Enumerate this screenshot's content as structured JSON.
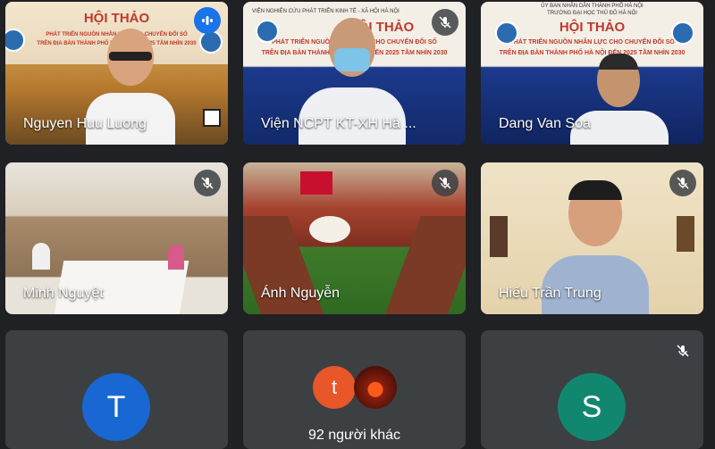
{
  "banner": {
    "org_top": "ỦY BAN NHÂN DÂN THÀNH PHỐ HÀ NỘI",
    "org_sub_left": "VIỆN NGHIÊN CỨU PHÁT TRIỂN KINH TẾ - XÃ HỘI HÀ NỘI",
    "org_sub_right": "TRƯỜNG ĐẠI HỌC THỦ ĐÔ HÀ NỘI",
    "title": "HỘI THẢO",
    "line1": "PHÁT TRIỂN NGUỒN NHÂN LỰC CHO CHUYỂN ĐỔI SỐ",
    "line2": "TRÊN ĐỊA BÀN THÀNH PHỐ HÀ NỘI ĐẾN 2025 TẦM NHÌN 2030"
  },
  "participants": [
    {
      "name": "Nguyen Huu Luong",
      "state": "speaking"
    },
    {
      "name": "Viện NCPT KT-XH Hà ...",
      "state": "muted"
    },
    {
      "name": "Dang Van Soa",
      "state": "unmuted"
    },
    {
      "name": "Minh Nguyệt",
      "state": "muted"
    },
    {
      "name": "Ánh Nguyễn",
      "state": "muted"
    },
    {
      "name": "Hiếu Trần Trung",
      "state": "muted"
    },
    {
      "name": "",
      "initial": "T",
      "state": "unmuted",
      "color": "#1967d2"
    },
    {
      "name": "",
      "initial": "S",
      "state": "muted",
      "color": "#12876f"
    }
  ],
  "others": {
    "initial": "t",
    "label": "92 người khác",
    "color": "#e8562a"
  },
  "colors": {
    "active_border": "#8ab4f8",
    "tile_bg": "#3c4043"
  }
}
